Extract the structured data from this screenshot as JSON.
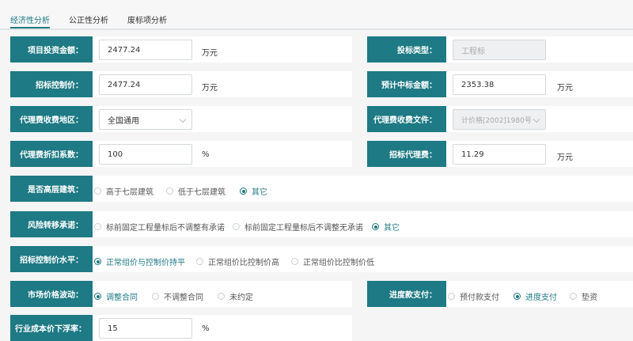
{
  "tabs": [
    {
      "label": "经济性分析",
      "active": true
    },
    {
      "label": "公正性分析",
      "active": false
    },
    {
      "label": "废标项分析",
      "active": false
    }
  ],
  "colors": {
    "accent": "#1e7a84",
    "label_text": "#ffffff"
  },
  "fields": {
    "investment": {
      "label": "项目投资金额：",
      "value": "2477.24",
      "unit": "万元"
    },
    "bid_type": {
      "label": "投标类型：",
      "value": "工程标"
    },
    "control_price": {
      "label": "招标控制价：",
      "value": "2477.24",
      "unit": "万元"
    },
    "expected_amount": {
      "label": "预计中标金额：",
      "value": "2353.38",
      "unit": "万元"
    },
    "fee_region": {
      "label": "代理费收费地区：",
      "value": "全国通用"
    },
    "fee_document": {
      "label": "代理费收费文件：",
      "value": "计价格[2002]1980号"
    },
    "discount": {
      "label": "代理费折扣系数：",
      "value": "100",
      "unit": "%"
    },
    "agency_fee": {
      "label": "招标代理费：",
      "value": "11.29",
      "unit": "万元"
    },
    "cost_float": {
      "label": "行业成本价下浮率：",
      "value": "15",
      "unit": "%"
    }
  },
  "radios": {
    "high_rise": {
      "label": "是否高层建筑：",
      "options": [
        "高于七层建筑",
        "低于七层建筑",
        "其它"
      ],
      "selected": 2
    },
    "risk_transfer": {
      "label": "风险转移承诺：",
      "options": [
        "标前固定工程量标后不调整有承诺",
        "标前固定工程量标后不调整无承诺",
        "其它"
      ],
      "selected": 2
    },
    "control_level": {
      "label": "招标控制价水平：",
      "options": [
        "正常组价与控制价持平",
        "正常组价比控制价高",
        "正常组价比控制价低"
      ],
      "selected": 0
    },
    "market_fluct": {
      "label": "市场价格波动：",
      "options": [
        "调整合同",
        "不调整合同",
        "未约定"
      ],
      "selected": 0
    },
    "progress_pay": {
      "label": "进度款支付：",
      "options": [
        "预付款支付",
        "进度支付",
        "垫资"
      ],
      "selected": 1
    }
  }
}
